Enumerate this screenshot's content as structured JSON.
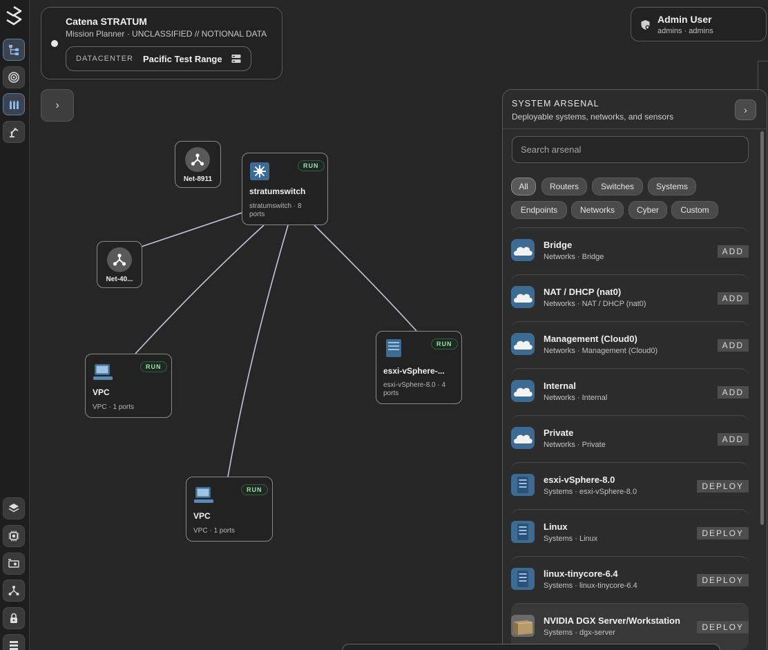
{
  "header": {
    "title": "Catena STRATUM",
    "subtitle": "Mission Planner · UNCLASSIFIED // NOTIONAL DATA",
    "datacenter_label": "DATACENTER",
    "datacenter_value": "Pacific Test Range"
  },
  "user": {
    "name": "Admin User",
    "role": "admins · admins"
  },
  "expand_glyph": "›",
  "nodes": [
    {
      "name": "stratumswitch",
      "meta": "stratumswitch · 8 ports",
      "status": "RUN"
    },
    {
      "name": "VPC",
      "meta": "VPC · 1 ports",
      "status": "RUN"
    },
    {
      "name": "esxi-vSphere-...",
      "meta": "esxi-vSphere-8.0 · 4 ports",
      "status": "RUN"
    },
    {
      "name": "VPC",
      "meta": "VPC · 1 ports",
      "status": "RUN"
    }
  ],
  "networks": [
    {
      "label": "Net-8911"
    },
    {
      "label": "Net-40..."
    }
  ],
  "arsenal": {
    "title": "SYSTEM ARSENAL",
    "subtitle": "Deployable systems, networks, and sensors",
    "collapse_glyph": "›",
    "search_placeholder": "Search arsenal",
    "filters": [
      "All",
      "Routers",
      "Switches",
      "Systems",
      "Endpoints",
      "Networks",
      "Cyber",
      "Custom"
    ],
    "selected_filter": "All",
    "items": [
      {
        "name": "Bridge",
        "meta": "Networks · Bridge",
        "action": "ADD",
        "icon": "cloud-icon"
      },
      {
        "name": "NAT / DHCP (nat0)",
        "meta": "Networks · NAT / DHCP (nat0)",
        "action": "ADD",
        "icon": "cloud-icon"
      },
      {
        "name": "Management (Cloud0)",
        "meta": "Networks · Management (Cloud0)",
        "action": "ADD",
        "icon": "cloud-icon"
      },
      {
        "name": "Internal",
        "meta": "Networks · Internal",
        "action": "ADD",
        "icon": "cloud-icon"
      },
      {
        "name": "Private",
        "meta": "Networks · Private",
        "action": "ADD",
        "icon": "cloud-icon"
      },
      {
        "name": "esxi-vSphere-8.0",
        "meta": "Systems · esxi-vSphere-8.0",
        "action": "DEPLOY",
        "icon": "server-icon"
      },
      {
        "name": "Linux",
        "meta": "Systems · Linux",
        "action": "DEPLOY",
        "icon": "server-icon"
      },
      {
        "name": "linux-tinycore-6.4",
        "meta": "Systems · linux-tinycore-6.4",
        "action": "DEPLOY",
        "icon": "server-icon"
      },
      {
        "name": "NVIDIA DGX Server/Workstation",
        "meta": "Systems · dgx-server",
        "action": "DEPLOY",
        "icon": "dgx-server-icon"
      }
    ]
  },
  "colors": {
    "background": "#262626",
    "link": "#c8c0e0",
    "run_text": "#9fe0a8",
    "accent": "#5b7fa6"
  }
}
